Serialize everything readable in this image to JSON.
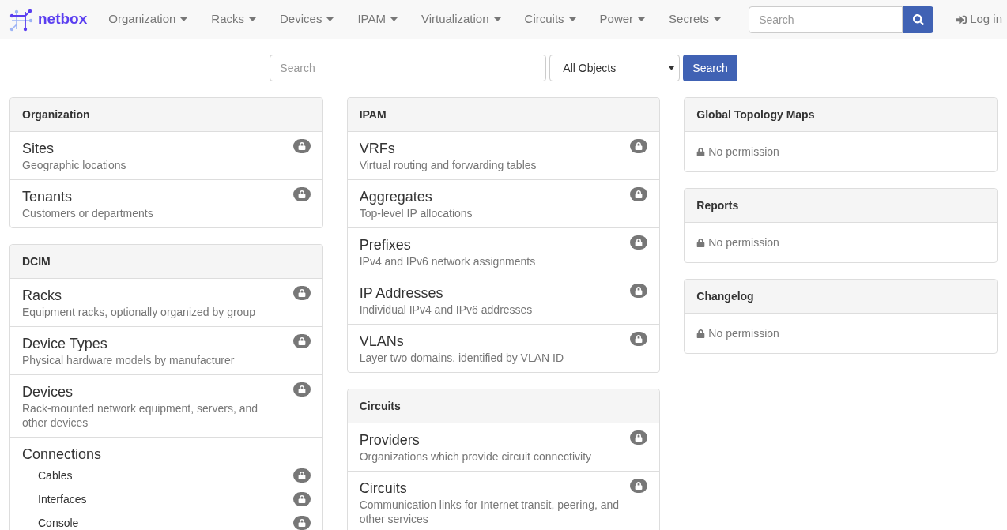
{
  "navbar": {
    "brand": "netbox",
    "menus": [
      "Organization",
      "Racks",
      "Devices",
      "IPAM",
      "Virtualization",
      "Circuits",
      "Power",
      "Secrets"
    ],
    "search": {
      "placeholder": "Search"
    },
    "login": "Log in"
  },
  "search_bar": {
    "placeholder": "Search",
    "scope": "All Objects",
    "button": "Search"
  },
  "columns": [
    [
      {
        "title": "Organization",
        "items": [
          {
            "name": "Sites",
            "description": "Geographic locations",
            "locked": true
          },
          {
            "name": "Tenants",
            "description": "Customers or departments",
            "locked": true
          }
        ]
      },
      {
        "title": "DCIM",
        "items": [
          {
            "name": "Racks",
            "description": "Equipment racks, optionally organized by group",
            "locked": true
          },
          {
            "name": "Device Types",
            "description": "Physical hardware models by manufacturer",
            "locked": true
          },
          {
            "name": "Devices",
            "description": "Rack-mounted network equipment, servers, and other devices",
            "locked": true
          },
          {
            "name": "Connections",
            "children": [
              {
                "name": "Cables",
                "locked": true
              },
              {
                "name": "Interfaces",
                "locked": true
              },
              {
                "name": "Console",
                "locked": true
              }
            ]
          }
        ]
      }
    ],
    [
      {
        "title": "IPAM",
        "items": [
          {
            "name": "VRFs",
            "description": "Virtual routing and forwarding tables",
            "locked": true
          },
          {
            "name": "Aggregates",
            "description": "Top-level IP allocations",
            "locked": true
          },
          {
            "name": "Prefixes",
            "description": "IPv4 and IPv6 network assignments",
            "locked": true
          },
          {
            "name": "IP Addresses",
            "description": "Individual IPv4 and IPv6 addresses",
            "locked": true
          },
          {
            "name": "VLANs",
            "description": "Layer two domains, identified by VLAN ID",
            "locked": true
          }
        ]
      },
      {
        "title": "Circuits",
        "items": [
          {
            "name": "Providers",
            "description": "Organizations which provide circuit connectivity",
            "locked": true
          },
          {
            "name": "Circuits",
            "description": "Communication links for Internet transit, peering, and other services",
            "locked": true
          }
        ]
      }
    ],
    [
      {
        "title": "Global Topology Maps",
        "message": "No permission"
      },
      {
        "title": "Reports",
        "message": "No permission"
      },
      {
        "title": "Changelog",
        "message": "No permission"
      }
    ]
  ]
}
